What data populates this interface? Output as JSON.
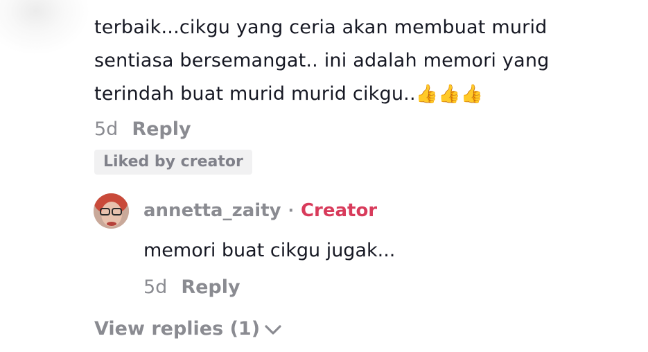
{
  "comment": {
    "lines": [
      "terbaik...cikgu yang ceria akan membuat murid",
      "sentiasa bersemangat.. ini adalah memori yang",
      "terindah buat murid murid cikgu.."
    ],
    "emoji": "👍👍👍",
    "time": "5d",
    "reply_label": "Reply",
    "liked_badge": "Liked by creator"
  },
  "reply": {
    "username": "annetta_zaity",
    "separator": "·",
    "creator_label": "Creator",
    "text": "memori buat cikgu jugak...",
    "time": "5d",
    "reply_label": "Reply"
  },
  "view_replies": {
    "label": "View replies (1)"
  },
  "colors": {
    "text_primary": "#161823",
    "text_secondary": "#8a8b91",
    "creator_accent": "#d83b5b",
    "badge_bg": "#f1f1f2"
  },
  "icons": {
    "avatar": "user-avatar",
    "expand": "chevron-down-icon"
  }
}
